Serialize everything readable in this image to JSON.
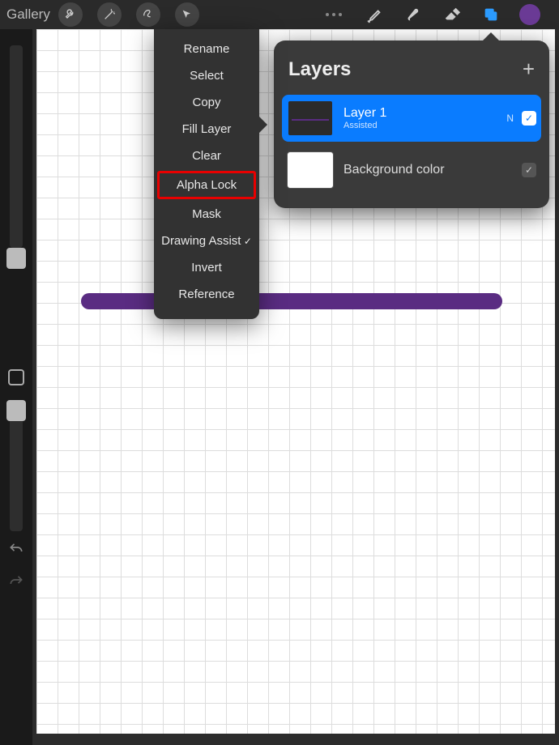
{
  "topbar": {
    "gallery": "Gallery"
  },
  "contextMenu": {
    "items": {
      "rename": "Rename",
      "select": "Select",
      "copy": "Copy",
      "fill": "Fill Layer",
      "clear": "Clear",
      "alphaLock": "Alpha Lock",
      "mask": "Mask",
      "drawingAssist": "Drawing Assist",
      "invert": "Invert",
      "reference": "Reference"
    }
  },
  "layersPanel": {
    "title": "Layers",
    "layer1": {
      "name": "Layer 1",
      "sub": "Assisted",
      "blend": "N"
    },
    "bg": {
      "name": "Background color"
    }
  }
}
